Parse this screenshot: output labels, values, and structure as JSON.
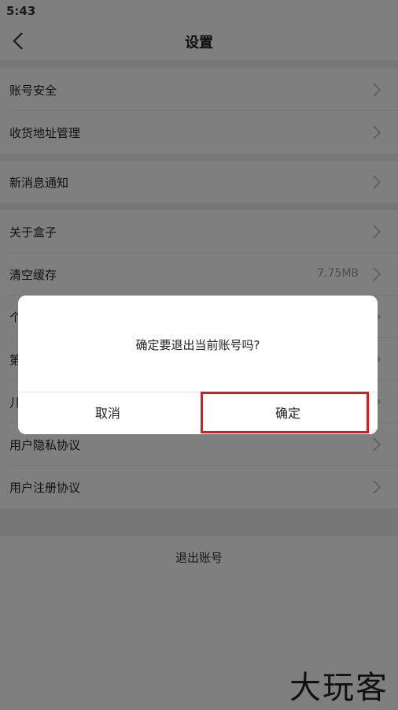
{
  "status_bar": {
    "time": "5:43"
  },
  "header": {
    "title": "设置"
  },
  "settings": {
    "group1": [
      {
        "label": "账号安全"
      },
      {
        "label": "收货地址管理"
      }
    ],
    "group2": [
      {
        "label": "新消息通知"
      }
    ],
    "group3": [
      {
        "label": "关于盒子"
      },
      {
        "label": "清空缓存",
        "value": "7.75MB"
      },
      {
        "label": "个"
      },
      {
        "label": "第"
      },
      {
        "label": "儿"
      },
      {
        "label": "用户隐私协议"
      },
      {
        "label": "用户注册协议"
      }
    ]
  },
  "logout": {
    "label": "退出账号"
  },
  "dialog": {
    "message": "确定要退出当前账号吗?",
    "cancel_label": "取消",
    "confirm_label": "确定"
  },
  "watermark": "大玩客",
  "colors": {
    "highlight": "#e01919",
    "overlay": "rgba(0,0,0,0.5)"
  }
}
